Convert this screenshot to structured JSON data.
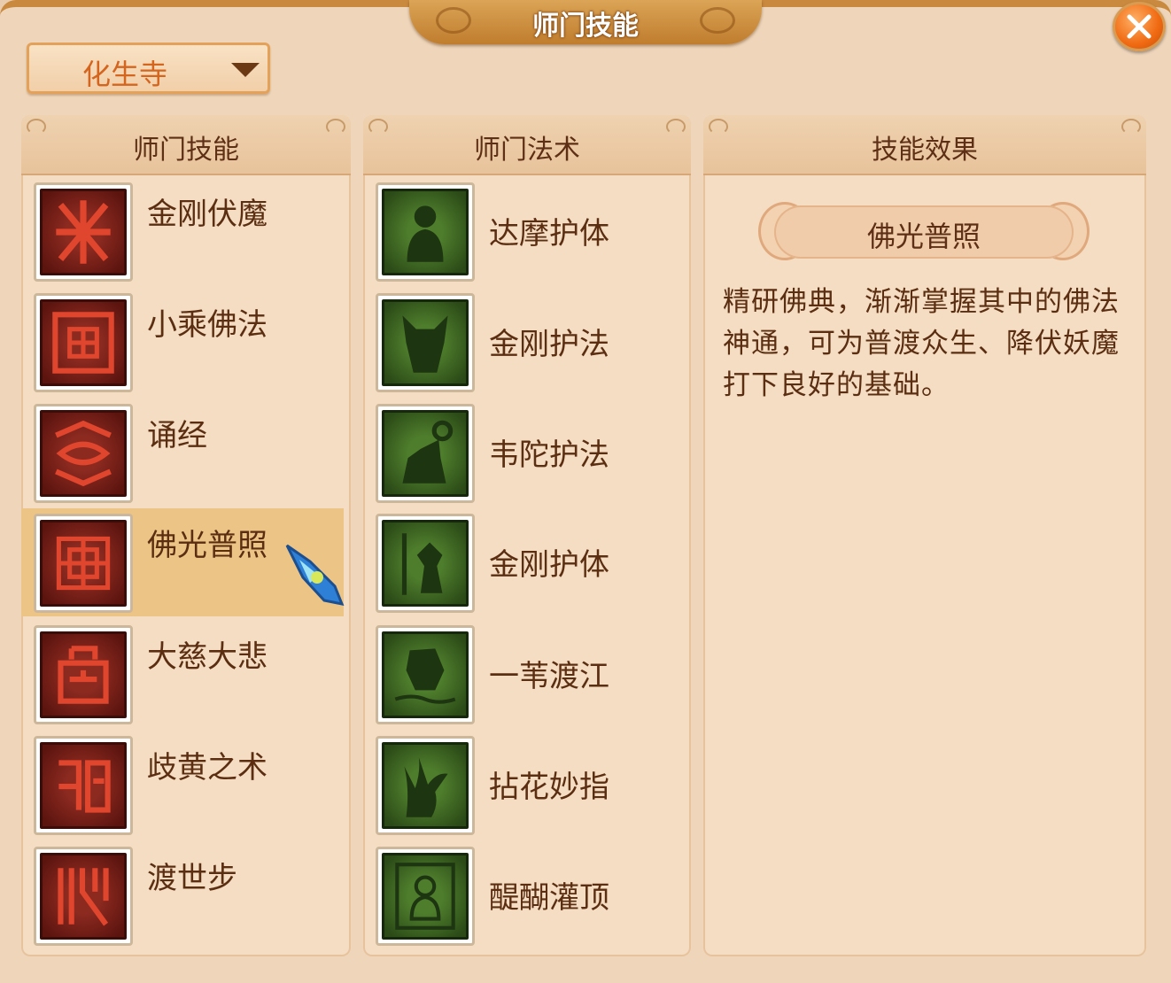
{
  "window": {
    "title": "师门技能"
  },
  "sect_selector": {
    "value": "化生寺"
  },
  "skills_panel": {
    "header": "师门技能",
    "items": [
      {
        "label": "金刚伏魔",
        "icon": "diamond-subdue-demon-icon"
      },
      {
        "label": "小乘佛法",
        "icon": "lesser-vehicle-icon"
      },
      {
        "label": "诵经",
        "icon": "chant-sutra-icon"
      },
      {
        "label": "佛光普照",
        "icon": "buddha-light-icon",
        "selected": true
      },
      {
        "label": "大慈大悲",
        "icon": "great-compassion-icon"
      },
      {
        "label": "歧黄之术",
        "icon": "medicine-art-icon"
      },
      {
        "label": "渡世步",
        "icon": "world-crossing-step-icon"
      }
    ]
  },
  "spells_panel": {
    "header": "师门法术",
    "items": [
      {
        "label": "达摩护体",
        "icon": "dharma-body-guard-icon"
      },
      {
        "label": "金刚护法",
        "icon": "vajra-guardian-icon"
      },
      {
        "label": "韦陀护法",
        "icon": "weituo-guardian-icon"
      },
      {
        "label": "金刚护体",
        "icon": "vajra-body-guard-icon"
      },
      {
        "label": "一苇渡江",
        "icon": "reed-cross-river-icon"
      },
      {
        "label": "拈花妙指",
        "icon": "flower-finger-icon"
      },
      {
        "label": "醍醐灌顶",
        "icon": "enlightenment-icon"
      }
    ]
  },
  "effect_panel": {
    "header": "技能效果",
    "skill_name": "佛光普照",
    "description": "精研佛典，渐渐掌握其中的佛法神通，可为普渡众生、降伏妖魔打下良好的基础。"
  },
  "colors": {
    "window_bg": "#efd6bb",
    "title_plate": "#c9893f",
    "close_button": "#f06a12",
    "selected_row": "#ecc486",
    "skill_icon": "#8c2a20",
    "spell_icon": "#4e7d2c",
    "text": "#5b2e12"
  }
}
